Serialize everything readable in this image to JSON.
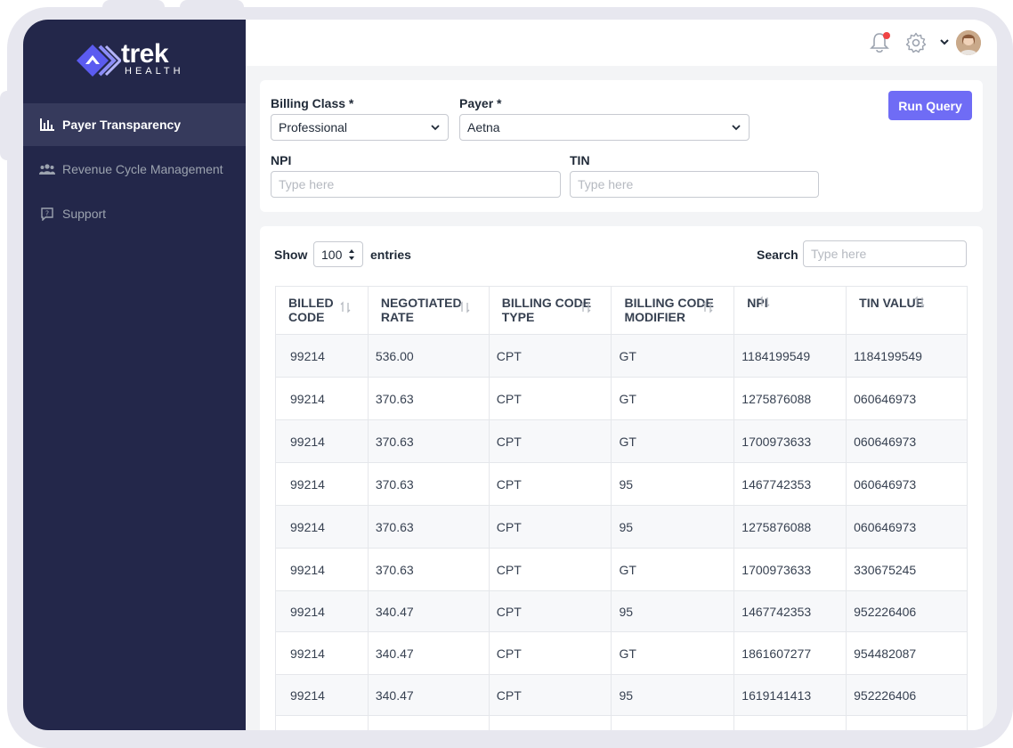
{
  "brand": {
    "name": "trek",
    "sub": "HEALTH"
  },
  "sidebar": {
    "items": [
      {
        "label": "Payer Transparency",
        "icon": "bar-chart-icon",
        "active": true
      },
      {
        "label": "Revenue Cycle Management",
        "icon": "users-icon",
        "active": false
      },
      {
        "label": "Support",
        "icon": "help-chat-icon",
        "active": false
      }
    ]
  },
  "header": {
    "icons": [
      "bell-icon",
      "gear-icon",
      "chevron-down-icon",
      "avatar"
    ]
  },
  "filters": {
    "billing_class": {
      "label": "Billing Class *",
      "value": "Professional"
    },
    "payer": {
      "label": "Payer *",
      "value": "Aetna"
    },
    "npi": {
      "label": "NPI",
      "placeholder": "Type here"
    },
    "tin": {
      "label": "TIN",
      "placeholder": "Type here"
    },
    "run_label": "Run Query"
  },
  "table_controls": {
    "show_label": "Show",
    "entries_value": "100",
    "entries_label": "entries",
    "search_label": "Search",
    "search_placeholder": "Type here"
  },
  "table": {
    "columns": [
      {
        "line1": "BILLED",
        "line2": "CODE"
      },
      {
        "line1": "NEGOTIATED",
        "line2": "RATE"
      },
      {
        "line1": "BILLING CODE",
        "line2": "TYPE"
      },
      {
        "line1": "BILLING CODE",
        "line2": "MODIFIER"
      },
      {
        "line1": "NPI",
        "line2": ""
      },
      {
        "line1": "TIN VALUE",
        "line2": ""
      }
    ],
    "rows": [
      [
        "99214",
        "536.00",
        "CPT",
        "GT",
        "1184199549",
        "1184199549"
      ],
      [
        "99214",
        "370.63",
        "CPT",
        "GT",
        "1275876088",
        "060646973"
      ],
      [
        "99214",
        "370.63",
        "CPT",
        "GT",
        "1700973633",
        "060646973"
      ],
      [
        "99214",
        "370.63",
        "CPT",
        "95",
        "1467742353",
        "060646973"
      ],
      [
        "99214",
        "370.63",
        "CPT",
        "95",
        "1275876088",
        "060646973"
      ],
      [
        "99214",
        "370.63",
        "CPT",
        "GT",
        "1700973633",
        "330675245"
      ],
      [
        "99214",
        "340.47",
        "CPT",
        "95",
        "1467742353",
        "952226406"
      ],
      [
        "99214",
        "340.47",
        "CPT",
        "GT",
        "1861607277",
        "954482087"
      ],
      [
        "99214",
        "340.47",
        "CPT",
        "95",
        "1619141413",
        "952226406"
      ],
      [
        "",
        "",
        "",
        "",
        "",
        ""
      ]
    ]
  },
  "colors": {
    "sidebar": "#23274a",
    "accent": "#6f6cf5",
    "notification": "#ef4444"
  }
}
